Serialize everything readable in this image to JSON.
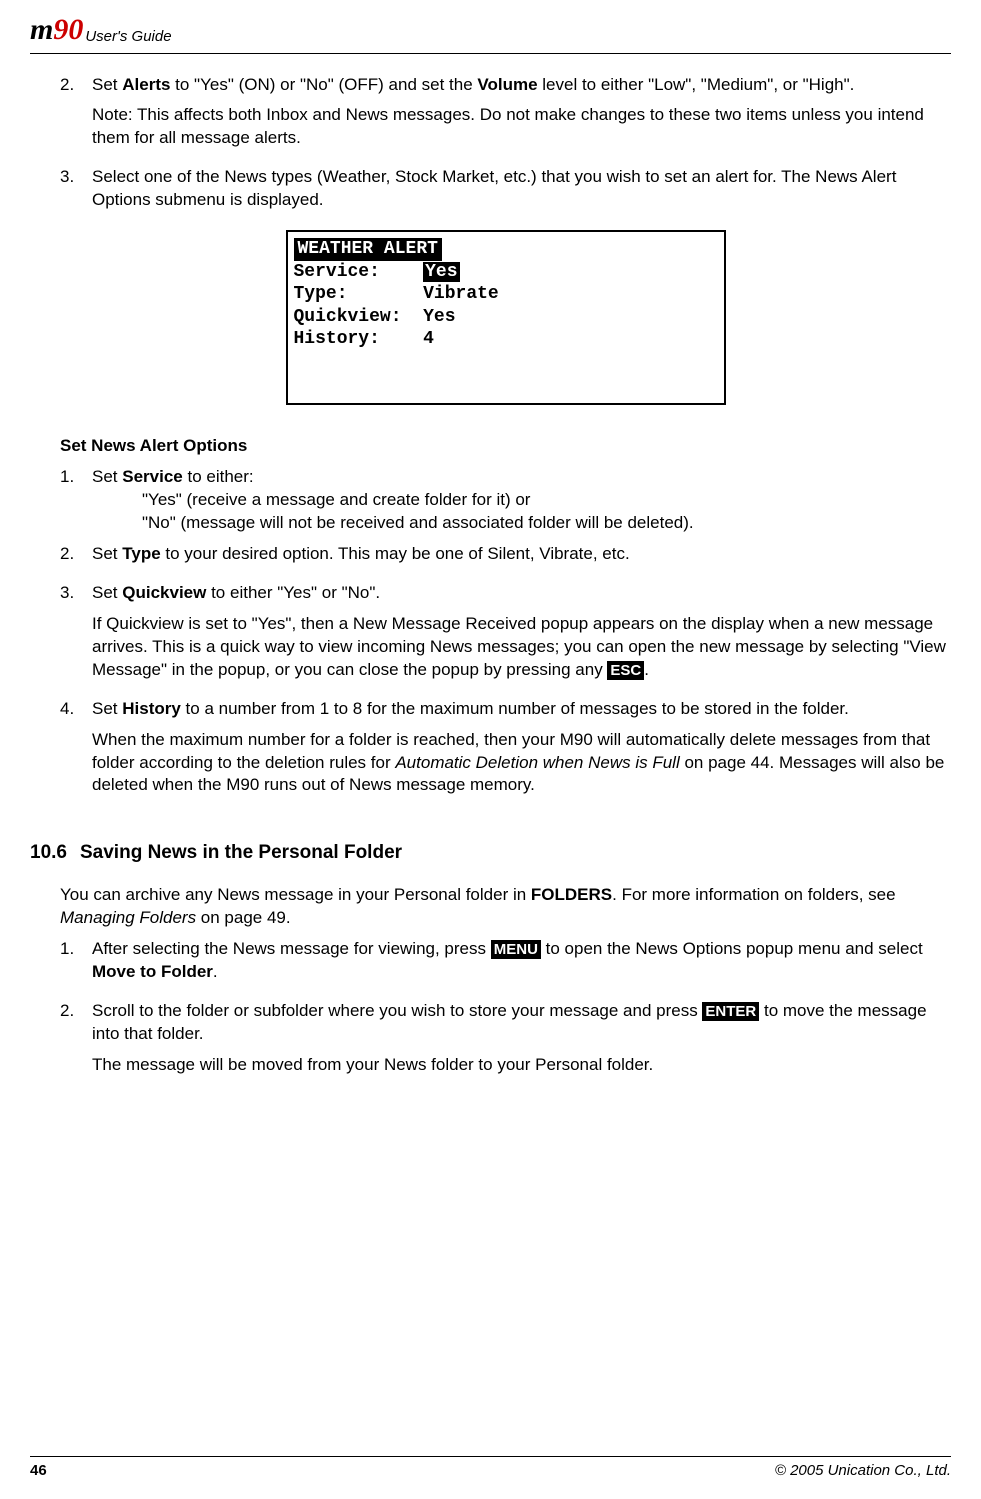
{
  "header": {
    "logo_m": "m",
    "logo_90": "90",
    "title": "User's Guide"
  },
  "steps_a": {
    "s2": {
      "num": "2.",
      "pre": "Set ",
      "b1": "Alerts",
      "mid1": " to \"Yes\" (ON) or \"No\" (OFF) and set the ",
      "b2": "Volume",
      "mid2": " level to either \"Low\", \"Medium\", or \"High\".",
      "note": "Note: This affects both Inbox and News messages. Do not make changes to these two items unless you intend them for all message alerts."
    },
    "s3": {
      "num": "3.",
      "text": "Select one of the News types (Weather, Stock Market, etc.) that you wish to set an alert for. The News Alert Options submenu is displayed."
    }
  },
  "screen": {
    "title": " WEATHER ALERT ",
    "r1a": "Service:    ",
    "r1b": "Yes",
    "r2": "Type:       Vibrate",
    "r3": "Quickview:  Yes",
    "r4": "History:    4"
  },
  "section_b": {
    "heading": "Set News Alert Options",
    "s1": {
      "num": "1.",
      "pre": "Set ",
      "b": "Service",
      "post": " to either:",
      "opt1": "\"Yes\" (receive a message and create folder for it) or",
      "opt2": "\"No\" (message will not be received and associated folder will be deleted)."
    },
    "s2": {
      "num": "2.",
      "pre": "Set ",
      "b": "Type",
      "post": " to your desired option. This may be one of Silent, Vibrate, etc."
    },
    "s3": {
      "num": "3.",
      "pre": "Set ",
      "b": "Quickview",
      "post": " to either \"Yes\" or \"No\".",
      "p2a": "If Quickview is set to \"Yes\", then a New Message Received popup appears on the display when a new message arrives. This is a quick way to view incoming News messages; you can open the new message by selecting \"View Message\" in the popup, or you can close the popup by pressing any ",
      "key": "ESC",
      "p2b": "."
    },
    "s4": {
      "num": "4.",
      "pre": "Set ",
      "b": "History",
      "post": " to a number from 1 to 8 for the maximum number of messages to be stored in the folder.",
      "p2a": "When the maximum number for a folder is reached, then your M90 will automatically delete messages from that folder according to the deletion rules for ",
      "p2i": "Automatic Deletion when News is Full",
      "p2b": " on page 44. Messages will also be deleted when the M90 runs out of News message memory."
    }
  },
  "section_c": {
    "num": "10.6",
    "title": "Saving News in the Personal Folder",
    "intro_a": "You can archive any News message in your Personal folder in ",
    "intro_b": "FOLDERS",
    "intro_c": ". For more information on folders, see ",
    "intro_i": "Managing Folders",
    "intro_d": " on page 49.",
    "s1": {
      "num": "1.",
      "a": "After selecting the News message for viewing, press ",
      "key": "MENU",
      "b": " to open the News Options popup menu and select ",
      "bold": "Move to Folder",
      "c": "."
    },
    "s2": {
      "num": "2.",
      "a": "Scroll to the folder or subfolder where you wish to store your message and press ",
      "key": "ENTER",
      "b": " to move the message into that folder.",
      "p2": "The message will be moved from your News folder to your Personal folder."
    }
  },
  "footer": {
    "page": "46",
    "copyright": "© 2005 Unication Co., Ltd."
  }
}
